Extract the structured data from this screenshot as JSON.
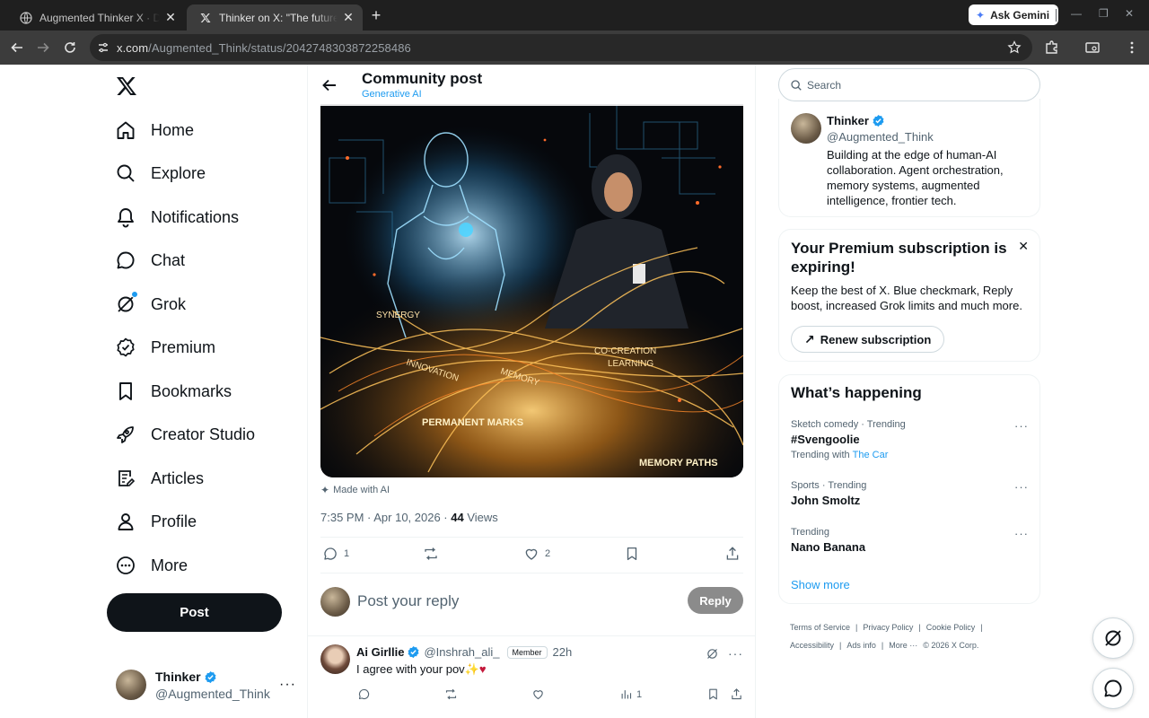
{
  "browser": {
    "tabs": [
      {
        "title": "Augmented Thinker X · Daily Po",
        "active": false
      },
      {
        "title": "Thinker on X: \"The future isn't p",
        "active": true
      }
    ],
    "gemini_label": "Ask Gemini",
    "url_host": "x.com",
    "url_path": "/Augmented_Think/status/2042748303872258486"
  },
  "sidebar": {
    "items": [
      {
        "label": "Home",
        "icon": "home-icon"
      },
      {
        "label": "Explore",
        "icon": "search-icon"
      },
      {
        "label": "Notifications",
        "icon": "bell-icon"
      },
      {
        "label": "Chat",
        "icon": "chat-bubble-icon"
      },
      {
        "label": "Grok",
        "icon": "grok-icon"
      },
      {
        "label": "Premium",
        "icon": "premium-badge-icon"
      },
      {
        "label": "Bookmarks",
        "icon": "bookmark-icon"
      },
      {
        "label": "Creator Studio",
        "icon": "rocket-icon"
      },
      {
        "label": "Articles",
        "icon": "article-icon"
      },
      {
        "label": "Profile",
        "icon": "person-icon"
      },
      {
        "label": "More",
        "icon": "more-circle-icon"
      }
    ],
    "post_label": "Post",
    "account": {
      "name": "Thinker",
      "handle": "@Augmented_Think"
    }
  },
  "post": {
    "header_title": "Community post",
    "community": "Generative AI",
    "image_labels": [
      "SYNERGY",
      "INNOVATION",
      "MEMORY",
      "CO-CREATION",
      "LEARNING",
      "PERMANENT MARKS",
      "MEMORY PATHS"
    ],
    "made_with_ai": "Made with AI",
    "timestamp": "7:35 PM · Apr 10, 2026 · ",
    "views_count": "44",
    "views_label": " Views",
    "replies": "1",
    "reposts": "",
    "likes": "2",
    "reply_placeholder": "Post your reply",
    "reply_button": "Reply"
  },
  "comment": {
    "name": "Ai Girllie",
    "handle": "@Inshrah_ali_",
    "badge": "Member",
    "time": "22h",
    "text": "I agree with your pov",
    "emoji_sparkle": "✨",
    "emoji_heart": "♥",
    "views": "1"
  },
  "right": {
    "search_placeholder": "Search",
    "profile": {
      "name": "Thinker",
      "handle": "@Augmented_Think",
      "bio": "Building at the edge of human-AI collaboration. Agent orchestration, memory systems, augmented intelligence, frontier tech."
    },
    "premium": {
      "title": "Your Premium subscription is expiring!",
      "desc": "Keep the best of X. Blue checkmark, Reply boost, increased Grok limits and much more.",
      "button": "Renew subscription"
    },
    "trends_title": "What’s happening",
    "trends": [
      {
        "context": "Sketch comedy · Trending",
        "name": "#Svengoolie",
        "with_prefix": "Trending with",
        "with_link": "The Car"
      },
      {
        "context": "Sports · Trending",
        "name": "John Smoltz"
      },
      {
        "context": "Trending",
        "name": "Nano Banana"
      }
    ],
    "show_more": "Show more",
    "footer": [
      "Terms of Service",
      "|",
      "Privacy Policy",
      "|",
      "Cookie Policy",
      "|",
      "Accessibility",
      "|",
      "Ads info",
      "|",
      "More ···",
      "© 2026 X Corp."
    ]
  },
  "colors": {
    "accent": "#1d9bf0",
    "text": "#0f1419",
    "muted": "#536471",
    "chrome_bg": "#1f1f1f",
    "chrome_toolbar": "#3c3c3c"
  }
}
